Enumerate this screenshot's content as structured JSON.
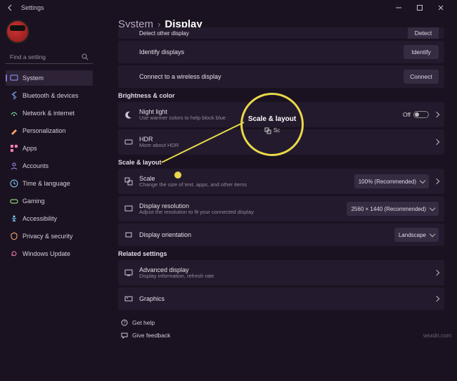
{
  "titlebar": {
    "title": "Settings"
  },
  "search": {
    "placeholder": "Find a setting"
  },
  "sidebar": {
    "items": [
      {
        "label": "System"
      },
      {
        "label": "Bluetooth & devices"
      },
      {
        "label": "Network & internet"
      },
      {
        "label": "Personalization"
      },
      {
        "label": "Apps"
      },
      {
        "label": "Accounts"
      },
      {
        "label": "Time & language"
      },
      {
        "label": "Gaming"
      },
      {
        "label": "Accessibility"
      },
      {
        "label": "Privacy & security"
      },
      {
        "label": "Windows Update"
      }
    ]
  },
  "breadcrumb": {
    "parent": "System",
    "sep": "›",
    "current": "Display"
  },
  "truncated": {
    "detect_title": "Detect other display",
    "detect_btn": "Detect"
  },
  "multi": {
    "identify_title": "Identify displays",
    "identify_btn": "Identify",
    "wireless_title": "Connect to a wireless display",
    "wireless_btn": "Connect"
  },
  "sections": {
    "brightness": "Brightness & color",
    "scale": "Scale & layout",
    "related": "Related settings"
  },
  "brightness": {
    "night_title": "Night light",
    "night_sub": "Use warmer colors to help block blue",
    "night_state": "Off",
    "hdr_title": "HDR",
    "hdr_sub": "More about HDR"
  },
  "scale": {
    "scale_title": "Scale",
    "scale_sub": "Change the size of text, apps, and other items",
    "scale_value": "100% (Recommended)",
    "res_title": "Display resolution",
    "res_sub": "Adjust the resolution to fit your connected display",
    "res_value": "2560 × 1440 (Recommended)",
    "orient_title": "Display orientation",
    "orient_value": "Landscape"
  },
  "related": {
    "adv_title": "Advanced display",
    "adv_sub": "Display information, refresh rate",
    "gfx_title": "Graphics"
  },
  "footer": {
    "help": "Get help",
    "feedback": "Give feedback"
  },
  "callout": {
    "label": "Scale & layout",
    "mini_sc": "Sc"
  }
}
